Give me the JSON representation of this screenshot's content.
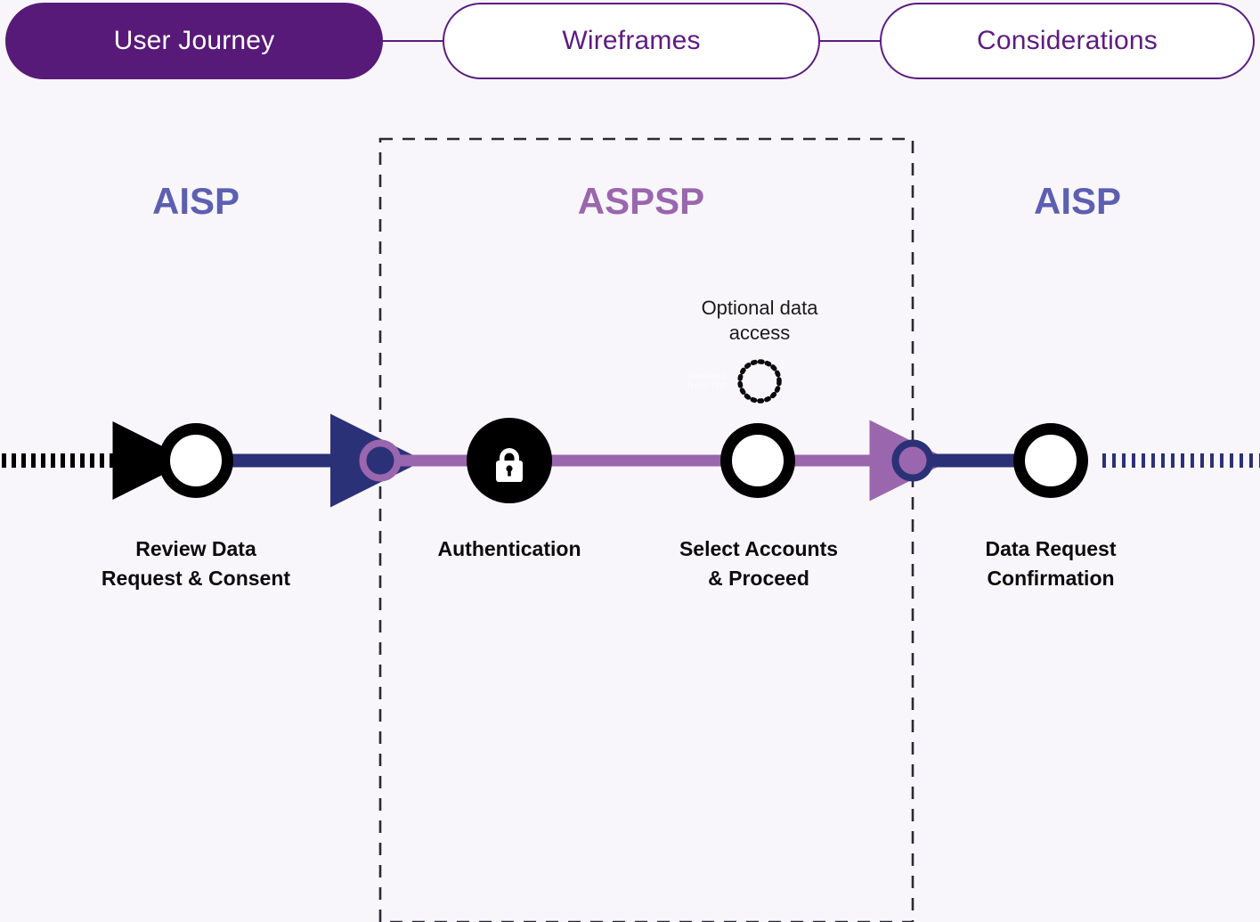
{
  "tabs": [
    {
      "label": "User Journey",
      "state": "active"
    },
    {
      "label": "Wireframes",
      "state": "inactive"
    },
    {
      "label": "Considerations",
      "state": "inactive"
    }
  ],
  "zones": [
    {
      "id": "aisp-left",
      "label": "AISP",
      "color": "#5d5fb0"
    },
    {
      "id": "aspsp",
      "label": "ASPSP",
      "color": "#9a66ae"
    },
    {
      "id": "aisp-right",
      "label": "AISP",
      "color": "#5d5fb0"
    }
  ],
  "steps": [
    {
      "id": "review-data-request-consent",
      "label": "Review Data\nRequest & Consent",
      "line1": "Review Data",
      "line2": "Request & Consent",
      "icon": "ring-node",
      "zone": "aisp-left"
    },
    {
      "id": "authentication",
      "label": "Authentication",
      "line1": "Authentication",
      "line2": "",
      "icon": "lock-icon",
      "zone": "aspsp"
    },
    {
      "id": "select-accounts-proceed",
      "label": "Select Accounts\n& Proceed",
      "line1": "Select Accounts",
      "line2": "& Proceed",
      "icon": "ring-node",
      "zone": "aspsp"
    },
    {
      "id": "data-request-confirmation",
      "label": "Data Request\nConfirmation",
      "line1": "Data Request",
      "line2": "Confirmation",
      "icon": "ring-node",
      "zone": "aisp-right"
    }
  ],
  "annotation": {
    "line1": "Optional data",
    "line2": "access",
    "marker": "dotted-circle-icon"
  },
  "watermark": {
    "line1": "Standard",
    "line2": "from TPP"
  },
  "colors": {
    "background": "#f8f6fa",
    "brand_purple": "#5c1d7e",
    "active_tab": "#581a78",
    "aisp_label": "#5d5fb0",
    "aspsp_label": "#9a66ae",
    "navy_line": "#2b3177",
    "orchid_line": "#9a66ae",
    "node_ring": "#000000",
    "node_fill": "#ffffff"
  }
}
